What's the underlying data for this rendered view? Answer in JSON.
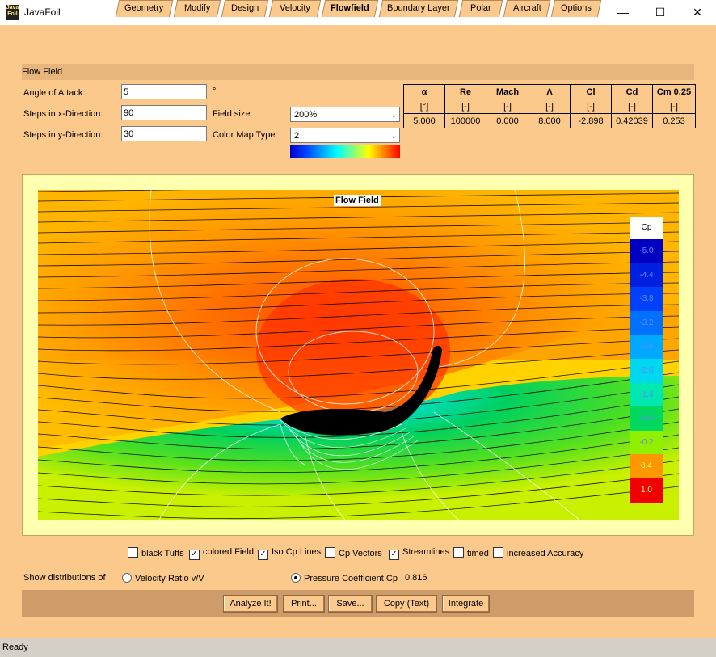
{
  "window": {
    "title": "JavaFoil",
    "icon_text": "Java Foil",
    "minimize": "—",
    "maximize": "☐",
    "close": "✕"
  },
  "tabs": [
    {
      "label": "Geometry"
    },
    {
      "label": "Modify"
    },
    {
      "label": "Design"
    },
    {
      "label": "Velocity"
    },
    {
      "label": "Flowfield"
    },
    {
      "label": "Boundary Layer"
    },
    {
      "label": "Polar"
    },
    {
      "label": "Aircraft"
    },
    {
      "label": "Options"
    }
  ],
  "section": {
    "title": "Flow Field"
  },
  "inputs": {
    "angle_label": "Angle of Attack:",
    "angle_value": "5",
    "angle_unit": "°",
    "stepsx_label": "Steps in x-Direction:",
    "stepsx_value": "90",
    "stepsy_label": "Steps in y-Direction:",
    "stepsy_value": "30",
    "fieldsize_label": "Field size:",
    "fieldsize_value": "200%",
    "colormap_label": "Color Map Type:",
    "colormap_value": "2"
  },
  "results": {
    "headers": [
      "α",
      "Re",
      "Mach",
      "Λ",
      "Cl",
      "Cd",
      "Cm 0.25"
    ],
    "units": [
      "[°]",
      "[-]",
      "[-]",
      "[-]",
      "[-]",
      "[-]",
      "[-]"
    ],
    "values": [
      "5.000",
      "100000",
      "0.000",
      "8.000",
      "-2.898",
      "0.42039",
      "0.253"
    ]
  },
  "plot": {
    "title": "Flow Field",
    "legend_title": "Cp",
    "legend": [
      {
        "label": "-5.0",
        "color": "#0000c0"
      },
      {
        "label": "-4.4",
        "color": "#0020e0"
      },
      {
        "label": "-3.8",
        "color": "#0040f8"
      },
      {
        "label": "-3.2",
        "color": "#0070ff"
      },
      {
        "label": "-2.6",
        "color": "#00a8ff"
      },
      {
        "label": "-2.0",
        "color": "#00d8f0"
      },
      {
        "label": "-1.4",
        "color": "#00e8b0"
      },
      {
        "label": "-0.8",
        "color": "#00d860"
      },
      {
        "label": "-0.2",
        "color": "#90f000"
      },
      {
        "label": "0.4",
        "color": "#ff9800"
      },
      {
        "label": "1.0",
        "color": "#f00000"
      }
    ]
  },
  "options": {
    "black_tufts": {
      "label": "black Tufts",
      "checked": false
    },
    "colored_field": {
      "label": "colored Field",
      "checked": true
    },
    "iso_cp": {
      "label": "Iso Cp Lines",
      "checked": true
    },
    "cp_vectors": {
      "label": "Cp Vectors",
      "checked": false
    },
    "streamlines": {
      "label": "Streamlines",
      "checked": true
    },
    "timed": {
      "label": "timed",
      "checked": false
    },
    "accuracy": {
      "label": "increased Accuracy",
      "checked": false
    }
  },
  "distribution": {
    "label": "Show distributions of",
    "velocity": "Velocity Ratio v/V",
    "pressure": "Pressure Coefficient Cp",
    "value": "0.816"
  },
  "buttons": {
    "analyze": "Analyze It!",
    "print": "Print...",
    "save": "Save...",
    "copy": "Copy (Text)",
    "integrate": "Integrate"
  },
  "status": "Ready"
}
